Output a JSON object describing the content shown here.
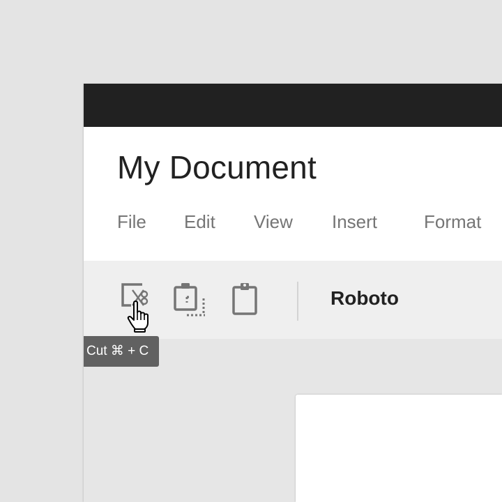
{
  "document": {
    "title": "My Document"
  },
  "menu": {
    "items": [
      "File",
      "Edit",
      "View",
      "Insert",
      "Format"
    ]
  },
  "toolbar": {
    "cut_icon": "cut-icon",
    "copy_icon": "copy-icon",
    "paste_icon": "paste-icon",
    "font_name": "Roboto"
  },
  "tooltip": {
    "text": "Cut ⌘ + C"
  },
  "colors": {
    "titlebar": "#212121",
    "header_bg": "#ffffff",
    "toolbar_bg": "#efefef",
    "icon": "#757575",
    "tooltip_bg": "#616161",
    "workspace_bg": "#e6e6e6"
  }
}
